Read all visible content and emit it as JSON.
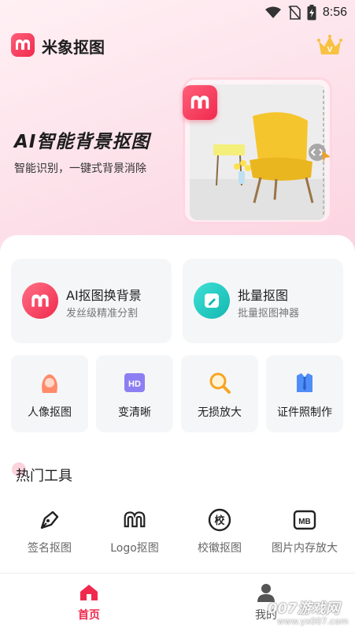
{
  "status_bar": {
    "time": "8:56",
    "icons": [
      "wifi-icon",
      "no-sim-icon",
      "battery-charging-icon"
    ]
  },
  "header": {
    "app_name": "米象抠图",
    "logo_icon": "elephant-logo-icon",
    "vip_icon": "crown-icon",
    "vip_badge": "V"
  },
  "hero": {
    "title": "AI智能背景抠图",
    "subtitle": "智能识别，一键式背景消除"
  },
  "features": [
    {
      "title": "AI抠图换背景",
      "desc": "发丝级精准分割",
      "icon": "elephant-icon"
    },
    {
      "title": "批量抠图",
      "desc": "批量抠图神器",
      "icon": "edit-icon"
    }
  ],
  "tools": [
    {
      "label": "人像抠图",
      "icon": "portrait-icon"
    },
    {
      "label": "变清晰",
      "icon": "hd-icon",
      "icon_text": "HD"
    },
    {
      "label": "无损放大",
      "icon": "magnifier-icon"
    },
    {
      "label": "证件照制作",
      "icon": "id-photo-icon"
    }
  ],
  "hot_tools": {
    "title": "热门工具",
    "items": [
      {
        "label": "签名抠图",
        "icon": "pen-nib-icon"
      },
      {
        "label": "Logo抠图",
        "icon": "elephant-outline-icon"
      },
      {
        "label": "校徽抠图",
        "icon": "school-badge-icon",
        "icon_text": "校"
      },
      {
        "label": "图片内存放大",
        "icon": "mb-icon",
        "icon_text": "MB"
      }
    ]
  },
  "bottom_nav": [
    {
      "label": "首页",
      "icon": "home-icon",
      "active": true
    },
    {
      "label": "我的",
      "icon": "profile-icon",
      "active": false
    }
  ],
  "watermark": {
    "text": "007游戏网",
    "url": "www.yx007.com"
  },
  "colors": {
    "accent": "#f02a4e",
    "teal": "#1fc9c1",
    "card_bg": "#f5f6f8"
  }
}
